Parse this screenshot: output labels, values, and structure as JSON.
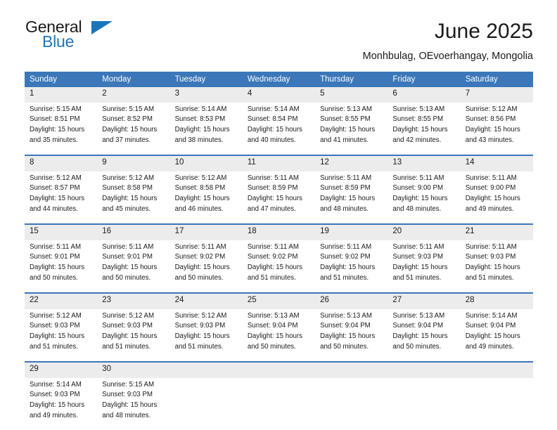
{
  "brand": {
    "name_part1": "General",
    "name_part2": "Blue",
    "triangle_color": "#1b75bb"
  },
  "header": {
    "title": "June 2025",
    "subtitle": "Monhbulag, OEvoerhangay, Mongolia"
  },
  "theme": {
    "header_blue": "#3b77b9",
    "daynum_gray": "#ececec",
    "text_color": "#1a1a1a"
  },
  "calendar": {
    "weekday_headers": [
      "Sunday",
      "Monday",
      "Tuesday",
      "Wednesday",
      "Thursday",
      "Friday",
      "Saturday"
    ],
    "weeks": [
      [
        {
          "day": "1",
          "sunrise": "Sunrise: 5:15 AM",
          "sunset": "Sunset: 8:51 PM",
          "daylight_1": "Daylight: 15 hours",
          "daylight_2": "and 35 minutes."
        },
        {
          "day": "2",
          "sunrise": "Sunrise: 5:15 AM",
          "sunset": "Sunset: 8:52 PM",
          "daylight_1": "Daylight: 15 hours",
          "daylight_2": "and 37 minutes."
        },
        {
          "day": "3",
          "sunrise": "Sunrise: 5:14 AM",
          "sunset": "Sunset: 8:53 PM",
          "daylight_1": "Daylight: 15 hours",
          "daylight_2": "and 38 minutes."
        },
        {
          "day": "4",
          "sunrise": "Sunrise: 5:14 AM",
          "sunset": "Sunset: 8:54 PM",
          "daylight_1": "Daylight: 15 hours",
          "daylight_2": "and 40 minutes."
        },
        {
          "day": "5",
          "sunrise": "Sunrise: 5:13 AM",
          "sunset": "Sunset: 8:55 PM",
          "daylight_1": "Daylight: 15 hours",
          "daylight_2": "and 41 minutes."
        },
        {
          "day": "6",
          "sunrise": "Sunrise: 5:13 AM",
          "sunset": "Sunset: 8:55 PM",
          "daylight_1": "Daylight: 15 hours",
          "daylight_2": "and 42 minutes."
        },
        {
          "day": "7",
          "sunrise": "Sunrise: 5:12 AM",
          "sunset": "Sunset: 8:56 PM",
          "daylight_1": "Daylight: 15 hours",
          "daylight_2": "and 43 minutes."
        }
      ],
      [
        {
          "day": "8",
          "sunrise": "Sunrise: 5:12 AM",
          "sunset": "Sunset: 8:57 PM",
          "daylight_1": "Daylight: 15 hours",
          "daylight_2": "and 44 minutes."
        },
        {
          "day": "9",
          "sunrise": "Sunrise: 5:12 AM",
          "sunset": "Sunset: 8:58 PM",
          "daylight_1": "Daylight: 15 hours",
          "daylight_2": "and 45 minutes."
        },
        {
          "day": "10",
          "sunrise": "Sunrise: 5:12 AM",
          "sunset": "Sunset: 8:58 PM",
          "daylight_1": "Daylight: 15 hours",
          "daylight_2": "and 46 minutes."
        },
        {
          "day": "11",
          "sunrise": "Sunrise: 5:11 AM",
          "sunset": "Sunset: 8:59 PM",
          "daylight_1": "Daylight: 15 hours",
          "daylight_2": "and 47 minutes."
        },
        {
          "day": "12",
          "sunrise": "Sunrise: 5:11 AM",
          "sunset": "Sunset: 8:59 PM",
          "daylight_1": "Daylight: 15 hours",
          "daylight_2": "and 48 minutes."
        },
        {
          "day": "13",
          "sunrise": "Sunrise: 5:11 AM",
          "sunset": "Sunset: 9:00 PM",
          "daylight_1": "Daylight: 15 hours",
          "daylight_2": "and 48 minutes."
        },
        {
          "day": "14",
          "sunrise": "Sunrise: 5:11 AM",
          "sunset": "Sunset: 9:00 PM",
          "daylight_1": "Daylight: 15 hours",
          "daylight_2": "and 49 minutes."
        }
      ],
      [
        {
          "day": "15",
          "sunrise": "Sunrise: 5:11 AM",
          "sunset": "Sunset: 9:01 PM",
          "daylight_1": "Daylight: 15 hours",
          "daylight_2": "and 50 minutes."
        },
        {
          "day": "16",
          "sunrise": "Sunrise: 5:11 AM",
          "sunset": "Sunset: 9:01 PM",
          "daylight_1": "Daylight: 15 hours",
          "daylight_2": "and 50 minutes."
        },
        {
          "day": "17",
          "sunrise": "Sunrise: 5:11 AM",
          "sunset": "Sunset: 9:02 PM",
          "daylight_1": "Daylight: 15 hours",
          "daylight_2": "and 50 minutes."
        },
        {
          "day": "18",
          "sunrise": "Sunrise: 5:11 AM",
          "sunset": "Sunset: 9:02 PM",
          "daylight_1": "Daylight: 15 hours",
          "daylight_2": "and 51 minutes."
        },
        {
          "day": "19",
          "sunrise": "Sunrise: 5:11 AM",
          "sunset": "Sunset: 9:02 PM",
          "daylight_1": "Daylight: 15 hours",
          "daylight_2": "and 51 minutes."
        },
        {
          "day": "20",
          "sunrise": "Sunrise: 5:11 AM",
          "sunset": "Sunset: 9:03 PM",
          "daylight_1": "Daylight: 15 hours",
          "daylight_2": "and 51 minutes."
        },
        {
          "day": "21",
          "sunrise": "Sunrise: 5:11 AM",
          "sunset": "Sunset: 9:03 PM",
          "daylight_1": "Daylight: 15 hours",
          "daylight_2": "and 51 minutes."
        }
      ],
      [
        {
          "day": "22",
          "sunrise": "Sunrise: 5:12 AM",
          "sunset": "Sunset: 9:03 PM",
          "daylight_1": "Daylight: 15 hours",
          "daylight_2": "and 51 minutes."
        },
        {
          "day": "23",
          "sunrise": "Sunrise: 5:12 AM",
          "sunset": "Sunset: 9:03 PM",
          "daylight_1": "Daylight: 15 hours",
          "daylight_2": "and 51 minutes."
        },
        {
          "day": "24",
          "sunrise": "Sunrise: 5:12 AM",
          "sunset": "Sunset: 9:03 PM",
          "daylight_1": "Daylight: 15 hours",
          "daylight_2": "and 51 minutes."
        },
        {
          "day": "25",
          "sunrise": "Sunrise: 5:13 AM",
          "sunset": "Sunset: 9:04 PM",
          "daylight_1": "Daylight: 15 hours",
          "daylight_2": "and 50 minutes."
        },
        {
          "day": "26",
          "sunrise": "Sunrise: 5:13 AM",
          "sunset": "Sunset: 9:04 PM",
          "daylight_1": "Daylight: 15 hours",
          "daylight_2": "and 50 minutes."
        },
        {
          "day": "27",
          "sunrise": "Sunrise: 5:13 AM",
          "sunset": "Sunset: 9:04 PM",
          "daylight_1": "Daylight: 15 hours",
          "daylight_2": "and 50 minutes."
        },
        {
          "day": "28",
          "sunrise": "Sunrise: 5:14 AM",
          "sunset": "Sunset: 9:04 PM",
          "daylight_1": "Daylight: 15 hours",
          "daylight_2": "and 49 minutes."
        }
      ],
      [
        {
          "day": "29",
          "sunrise": "Sunrise: 5:14 AM",
          "sunset": "Sunset: 9:03 PM",
          "daylight_1": "Daylight: 15 hours",
          "daylight_2": "and 49 minutes."
        },
        {
          "day": "30",
          "sunrise": "Sunrise: 5:15 AM",
          "sunset": "Sunset: 9:03 PM",
          "daylight_1": "Daylight: 15 hours",
          "daylight_2": "and 48 minutes."
        },
        {
          "day": "",
          "sunrise": "",
          "sunset": "",
          "daylight_1": "",
          "daylight_2": ""
        },
        {
          "day": "",
          "sunrise": "",
          "sunset": "",
          "daylight_1": "",
          "daylight_2": ""
        },
        {
          "day": "",
          "sunrise": "",
          "sunset": "",
          "daylight_1": "",
          "daylight_2": ""
        },
        {
          "day": "",
          "sunrise": "",
          "sunset": "",
          "daylight_1": "",
          "daylight_2": ""
        },
        {
          "day": "",
          "sunrise": "",
          "sunset": "",
          "daylight_1": "",
          "daylight_2": ""
        }
      ]
    ]
  }
}
